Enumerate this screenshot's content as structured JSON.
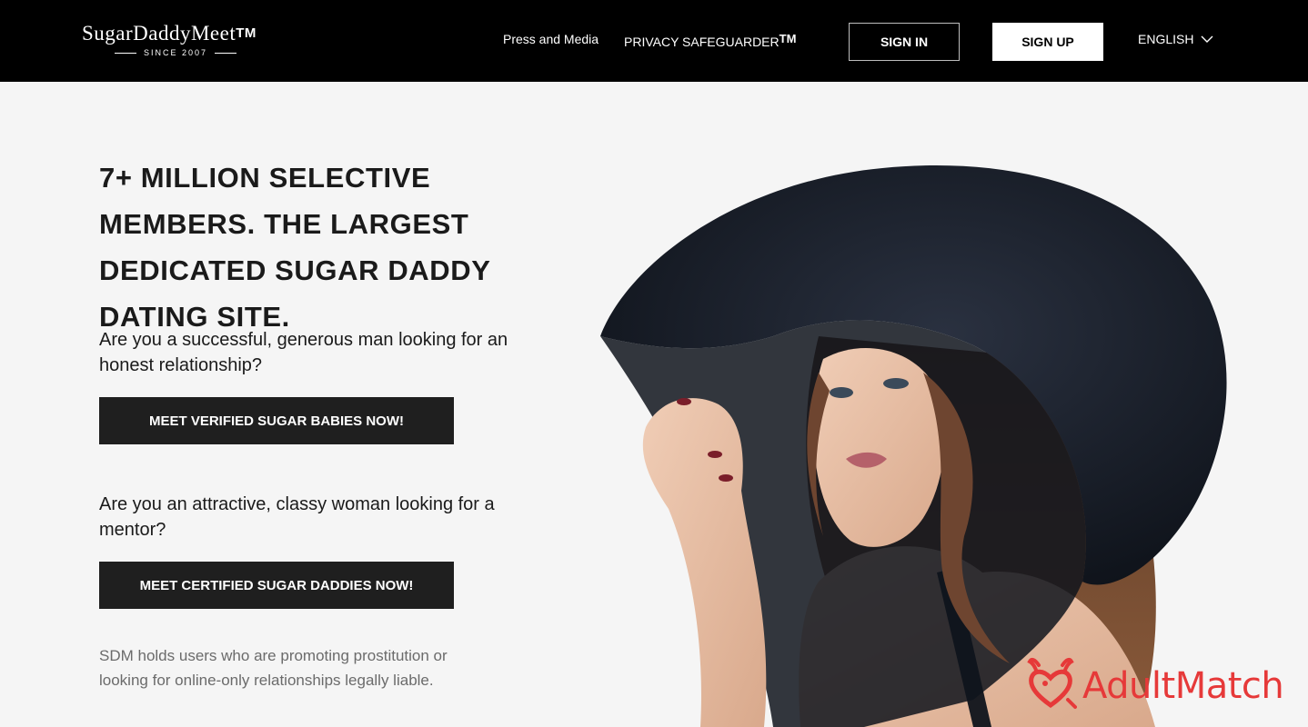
{
  "header": {
    "logo": {
      "wordmark": "SugarDaddyMeet",
      "tm": "TM",
      "tagline": "SINCE 2007"
    },
    "nav": {
      "press": "Press and Media",
      "privacy": "PRIVACY SAFEGUARDER",
      "privacy_tm": "TM"
    },
    "sign_in": "SIGN IN",
    "sign_up": "SIGN UP",
    "language": "ENGLISH"
  },
  "hero": {
    "headline": "7+ MILLION SELECTIVE MEMBERS. THE LARGEST DEDICATED SUGAR DADDY DATING SITE.",
    "question_men": "Are you a successful, generous man looking for an honest relationship?",
    "cta_men": "MEET VERIFIED SUGAR BABIES NOW!",
    "question_women": "Are you an attractive, classy woman looking for a mentor?",
    "cta_women": "MEET CERTIFIED SUGAR DADDIES NOW!",
    "disclaimer": "SDM holds users who are promoting prostitution or looking for online-only relationships legally liable."
  },
  "watermark": {
    "text": "AdultMatch"
  },
  "colors": {
    "header_bg": "#000000",
    "page_bg": "#f5f5f5",
    "button_dark": "#1f1f1f",
    "watermark": "#e63939"
  }
}
